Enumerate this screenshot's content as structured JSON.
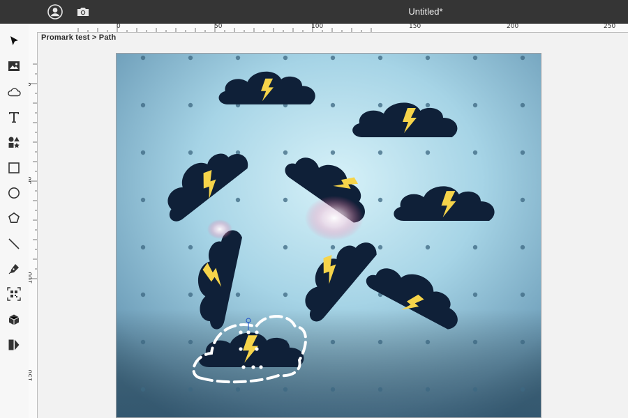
{
  "window": {
    "title": "Untitled*"
  },
  "titlebar_icons": [
    "account-icon",
    "camera-icon"
  ],
  "toolbar": {
    "tools": [
      "select-arrow-icon",
      "image-icon",
      "cloud-icon",
      "text-icon",
      "elements-icon",
      "rectangle-icon",
      "circle-icon",
      "polygon-icon",
      "line-icon",
      "pen-icon",
      "qr-code-icon",
      "box-3d-icon",
      "dxf-icon"
    ]
  },
  "ruler": {
    "top_labels": [
      "0",
      "50",
      "100",
      "150",
      "200",
      "250"
    ],
    "left_labels": [
      "0",
      "50",
      "100",
      "150"
    ]
  },
  "breadcrumb": "Promark test > Path",
  "canvas": {
    "content": "camera-preview-with-cloud-lightning-shapes",
    "colors": {
      "bg_light": "#bfe6f2",
      "bg_mid": "#8fc2d8",
      "cloud": "#0f2038",
      "bolt": "#f6d44a",
      "selection": "#ffffff"
    }
  }
}
